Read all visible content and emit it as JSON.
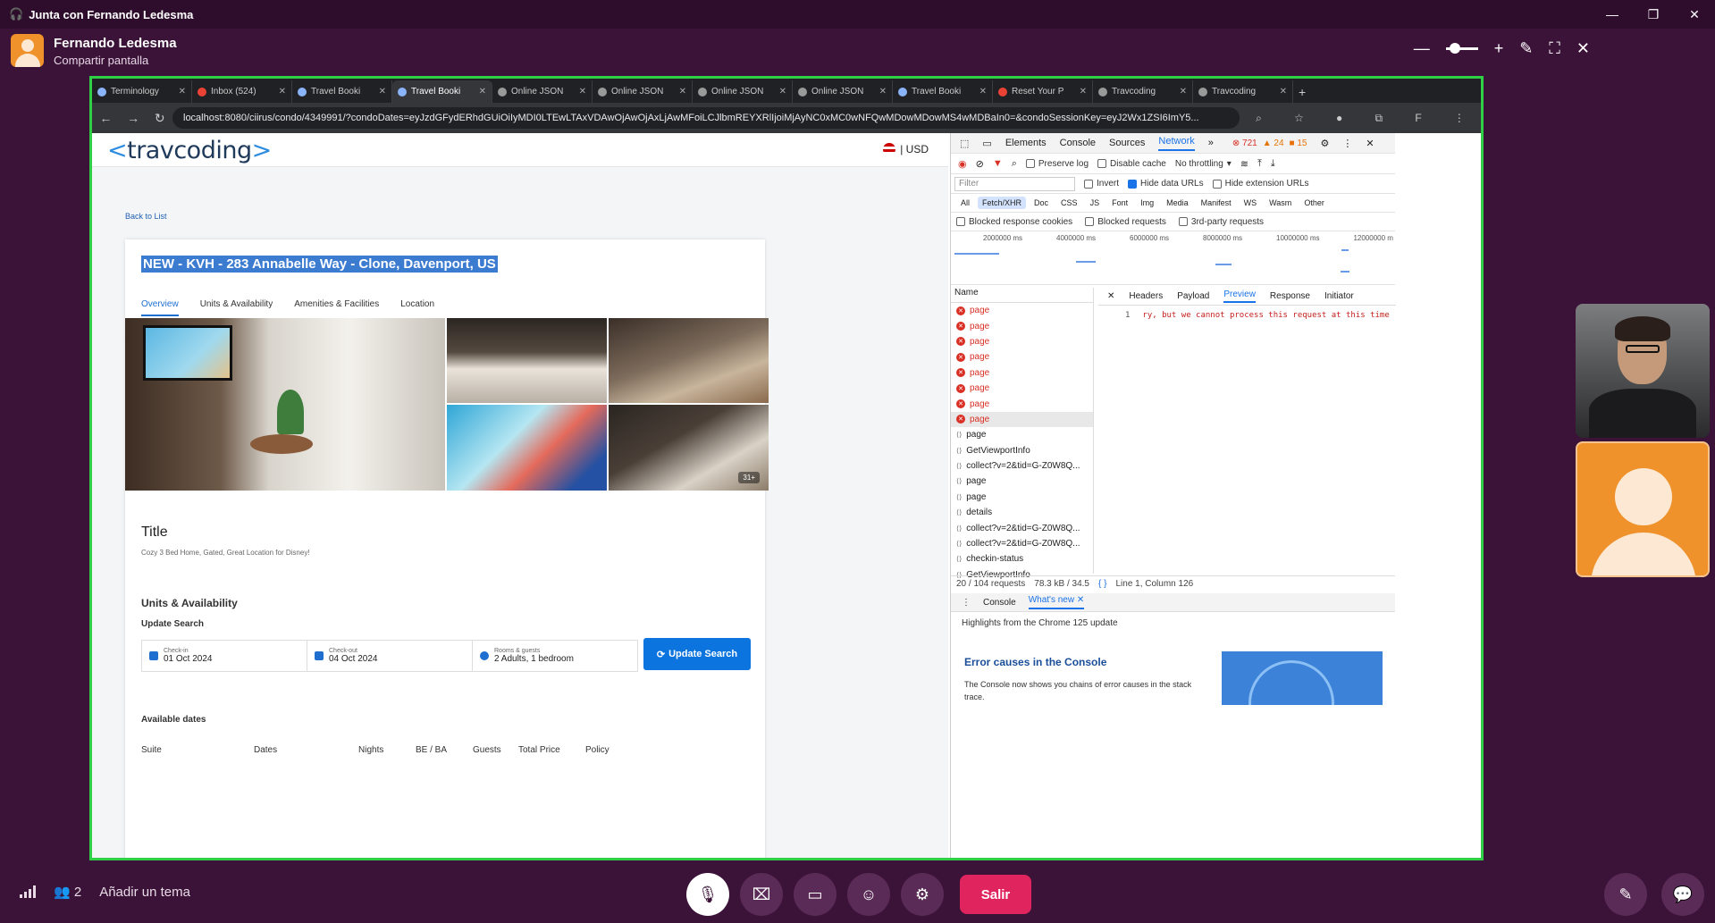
{
  "window": {
    "title": "Junta con Fernando Ledesma"
  },
  "meeting": {
    "host_name": "Fernando Ledesma",
    "host_subtitle": "Compartir pantalla",
    "participants_count": "2",
    "topic_placeholder": "Añadir un tema",
    "leave_label": "Salir"
  },
  "browser": {
    "tabs": [
      {
        "label": "Terminology"
      },
      {
        "label": "Inbox (524)"
      },
      {
        "label": "Travel Booki"
      },
      {
        "label": "Travel Booki"
      },
      {
        "label": "Online JSON"
      },
      {
        "label": "Online JSON"
      },
      {
        "label": "Online JSON"
      },
      {
        "label": "Online JSON"
      },
      {
        "label": "Travel Booki"
      },
      {
        "label": "Reset Your P"
      },
      {
        "label": "Travcoding"
      },
      {
        "label": "Travcoding"
      }
    ],
    "url": "localhost:8080/ciirus/condo/4349991/?condoDates=eyJzdGFydERhdGUiOiIyMDI0LTEwLTAxVDAwOjAwOjAxLjAwMFoiLCJlbmREYXRlIjoiMjAyNC0xMC0wNFQwMDowMDowMS4wMDBaIn0=&condoSessionKey=eyJ2Wx1ZSI6ImY5..."
  },
  "site": {
    "logo": "travcoding",
    "currency": "USD",
    "back_link": "Back to List",
    "property_title": "NEW - KVH - 283 Annabelle Way - Clone, Davenport, US",
    "tabs": [
      "Overview",
      "Units & Availability",
      "Amenities & Facilities",
      "Location"
    ],
    "photo_count": "31+",
    "title_heading": "Title",
    "title_text": "Cozy 3 Bed Home, Gated, Great Location for Disney!",
    "units_heading": "Units & Availability",
    "update_search_heading": "Update Search",
    "checkin_label": "Check-in",
    "checkin_value": "01 Oct 2024",
    "checkout_label": "Check-out",
    "checkout_value": "04 Oct 2024",
    "guests_label": "Rooms & guests",
    "guests_value": "2 Adults, 1 bedroom",
    "update_button": "Update Search",
    "available_heading": "Available dates",
    "table_headers": [
      "Suite",
      "Dates",
      "Nights",
      "BE / BA",
      "Guests",
      "Total Price",
      "Policy"
    ]
  },
  "devtools": {
    "tabs": [
      "Elements",
      "Console",
      "Sources",
      "Network"
    ],
    "errors": "721",
    "warnings": "24",
    "issues": "15",
    "preserve_log": "Preserve log",
    "disable_cache": "Disable cache",
    "throttling": "No throttling",
    "filter_placeholder": "Filter",
    "invert": "Invert",
    "hide_data_urls": "Hide data URLs",
    "hide_ext_urls": "Hide extension URLs",
    "types": [
      "All",
      "Fetch/XHR",
      "Doc",
      "CSS",
      "JS",
      "Font",
      "Img",
      "Media",
      "Manifest",
      "WS",
      "Wasm",
      "Other"
    ],
    "blocked_cookies": "Blocked response cookies",
    "blocked_requests": "Blocked requests",
    "third_party": "3rd-party requests",
    "timeline_labels": [
      "2000000 ms",
      "4000000 ms",
      "6000000 ms",
      "8000000 ms",
      "10000000 ms",
      "12000000 m"
    ],
    "name_header": "Name",
    "requests": [
      {
        "name": "page",
        "error": true
      },
      {
        "name": "page",
        "error": true
      },
      {
        "name": "page",
        "error": true
      },
      {
        "name": "page",
        "error": true
      },
      {
        "name": "page",
        "error": true
      },
      {
        "name": "page",
        "error": true
      },
      {
        "name": "page",
        "error": true
      },
      {
        "name": "page",
        "error": true
      },
      {
        "name": "page",
        "error": false
      },
      {
        "name": "GetViewportInfo",
        "error": false
      },
      {
        "name": "collect?v=2&tid=G-Z0W8Q...",
        "error": false
      },
      {
        "name": "page",
        "error": false
      },
      {
        "name": "page",
        "error": false
      },
      {
        "name": "details",
        "error": false
      },
      {
        "name": "collect?v=2&tid=G-Z0W8Q...",
        "error": false
      },
      {
        "name": "collect?v=2&tid=G-Z0W8Q...",
        "error": false
      },
      {
        "name": "checkin-status",
        "error": false
      },
      {
        "name": "GetViewportInfo",
        "error": false
      }
    ],
    "detail_tabs": [
      "Headers",
      "Payload",
      "Preview",
      "Response",
      "Initiator"
    ],
    "preview_line_number": "1",
    "preview_text": "ry, but we cannot process this request at this time",
    "status_requests": "20 / 104 requests",
    "status_transfer": "78.3 kB / 34.5",
    "status_position": "Line 1, Column 126",
    "drawer_tabs": [
      "Console",
      "What's new"
    ],
    "whats_new_heading": "Highlights from the Chrome 125 update",
    "whats_new_title": "Error causes in the Console",
    "whats_new_body": "The Console now shows you chains of error causes in the stack trace."
  }
}
